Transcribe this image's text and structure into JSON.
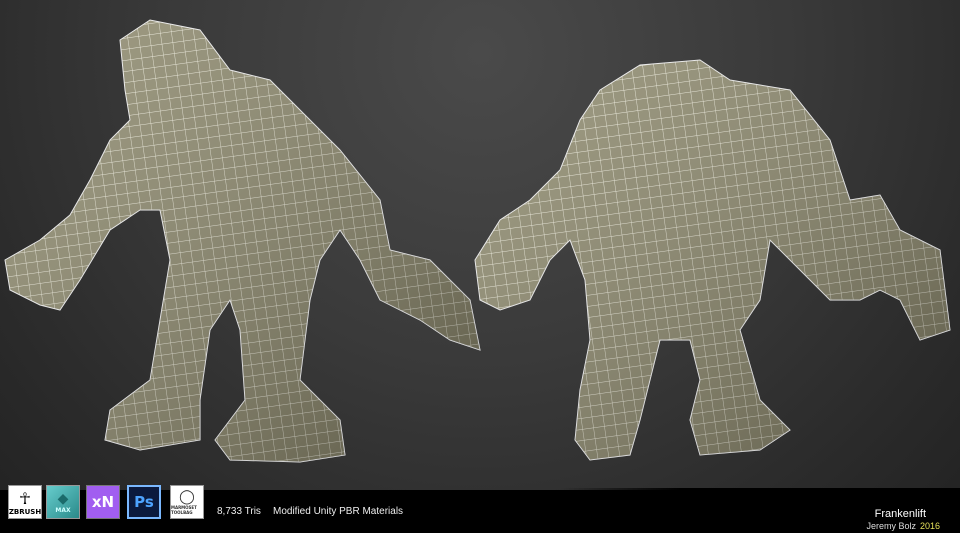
{
  "logos": [
    {
      "icon": "zbrush-logo",
      "label": "ZBRUSH"
    },
    {
      "icon": "3ds-max-logo",
      "label": "MAX"
    },
    {
      "icon": "xnormal-logo",
      "label": "xN"
    },
    {
      "icon": "photoshop-logo",
      "label": "Ps"
    },
    {
      "icon": "marmoset-toolbag-logo",
      "label": "MARMOSET TOOLBAG"
    }
  ],
  "info": {
    "tris": "8,733 Tris",
    "materials": "Modified Unity PBR Materials"
  },
  "credits": {
    "title": "Frankenlift",
    "author": "Jeremy Bolz",
    "year": "2016"
  },
  "colors": {
    "mesh": "#8f8b6e",
    "wire": "#f2f0e0",
    "year": "#e6e05a"
  }
}
